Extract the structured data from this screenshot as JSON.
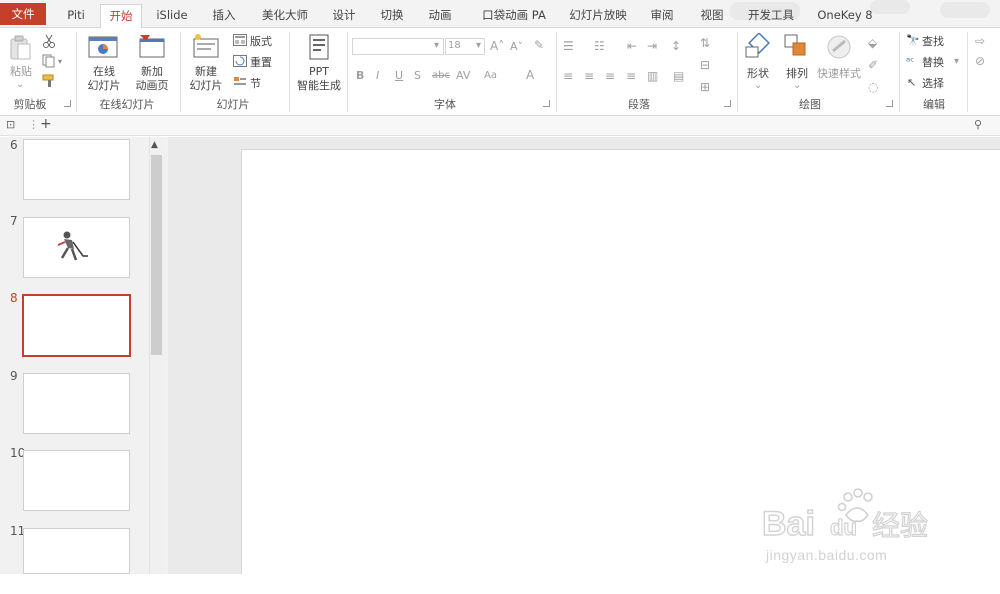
{
  "tabs": {
    "file": "文件",
    "piti": "Piti",
    "home": "开始",
    "islide": "iSlide",
    "insert": "插入",
    "meihua": "美化大师",
    "design": "设计",
    "transitions": "切换",
    "animations": "动画",
    "pocket": "口袋动画 PA",
    "slideshow": "幻灯片放映",
    "review": "审阅",
    "view": "视图",
    "developer": "开发工具",
    "onekey": "OneKey 8"
  },
  "ribbon": {
    "clipboard": {
      "paste": "粘贴",
      "label": "剪贴板"
    },
    "online": {
      "online_slides": "在线",
      "online_slides2": "幻灯片",
      "new_anim": "新加",
      "new_anim2": "动画页",
      "label": "在线幻灯片"
    },
    "slides": {
      "new_slide": "新建",
      "new_slide2": "幻灯片",
      "layout": "版式",
      "reset": "重置",
      "section": "节",
      "label": "幻灯片"
    },
    "ppt_gen": {
      "line1": "PPT",
      "line2": "智能生成"
    },
    "font": {
      "size": "18",
      "label": "字体"
    },
    "paragraph": {
      "label": "段落"
    },
    "drawing": {
      "shapes": "形状",
      "arrange": "排列",
      "quick_styles": "快速样式",
      "label": "绘图"
    },
    "editing": {
      "find": "查找",
      "replace": "替换",
      "select": "选择",
      "label": "编辑"
    }
  },
  "slides": [
    {
      "number": "6"
    },
    {
      "number": "7"
    },
    {
      "number": "8"
    },
    {
      "number": "9"
    },
    {
      "number": "10"
    },
    {
      "number": "11"
    }
  ],
  "watermark": {
    "logo": "Bai du 经验",
    "url": "jingyan.baidu.com"
  },
  "colors": {
    "accent": "#c4402a",
    "background": "#ffffff",
    "pane": "#f1f1f1"
  }
}
